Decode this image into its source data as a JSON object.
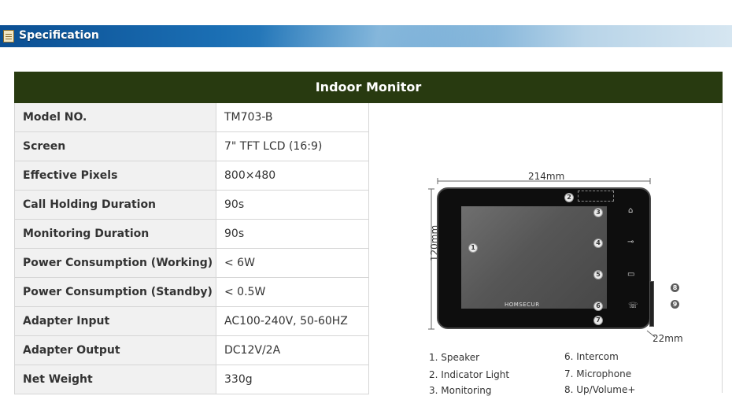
{
  "banner": {
    "title": "Specification"
  },
  "table": {
    "header": "Indoor Monitor",
    "rows": [
      {
        "key": "Model NO.",
        "value": "TM703-B"
      },
      {
        "key": "Screen",
        "value": "7\" TFT LCD (16:9)"
      },
      {
        "key": "Effective Pixels",
        "value": "800×480"
      },
      {
        "key": "Call Holding Duration",
        "value": "90s"
      },
      {
        "key": "Monitoring Duration",
        "value": "90s"
      },
      {
        "key": "Power Consumption (Working)",
        "value": "< 6W"
      },
      {
        "key": "Power Consumption (Standby)",
        "value": "< 0.5W"
      },
      {
        "key": "Adapter Input",
        "value": "AC100-240V, 50-60HZ"
      },
      {
        "key": "Adapter Output",
        "value": "DC12V/2A"
      },
      {
        "key": "Net Weight",
        "value": "330g"
      }
    ]
  },
  "diagram": {
    "width_label": "214mm",
    "height_label": "120mm",
    "depth_label": "22mm",
    "logo_text": "HOMSECUR",
    "callouts": [
      "1",
      "2",
      "3",
      "4",
      "5",
      "6",
      "7",
      "8",
      "9"
    ],
    "legend": [
      "1. Speaker",
      "2. Indicator Light",
      "3. Monitoring",
      "6. Intercom",
      "7. Microphone",
      "8. Up/Volume+"
    ]
  }
}
